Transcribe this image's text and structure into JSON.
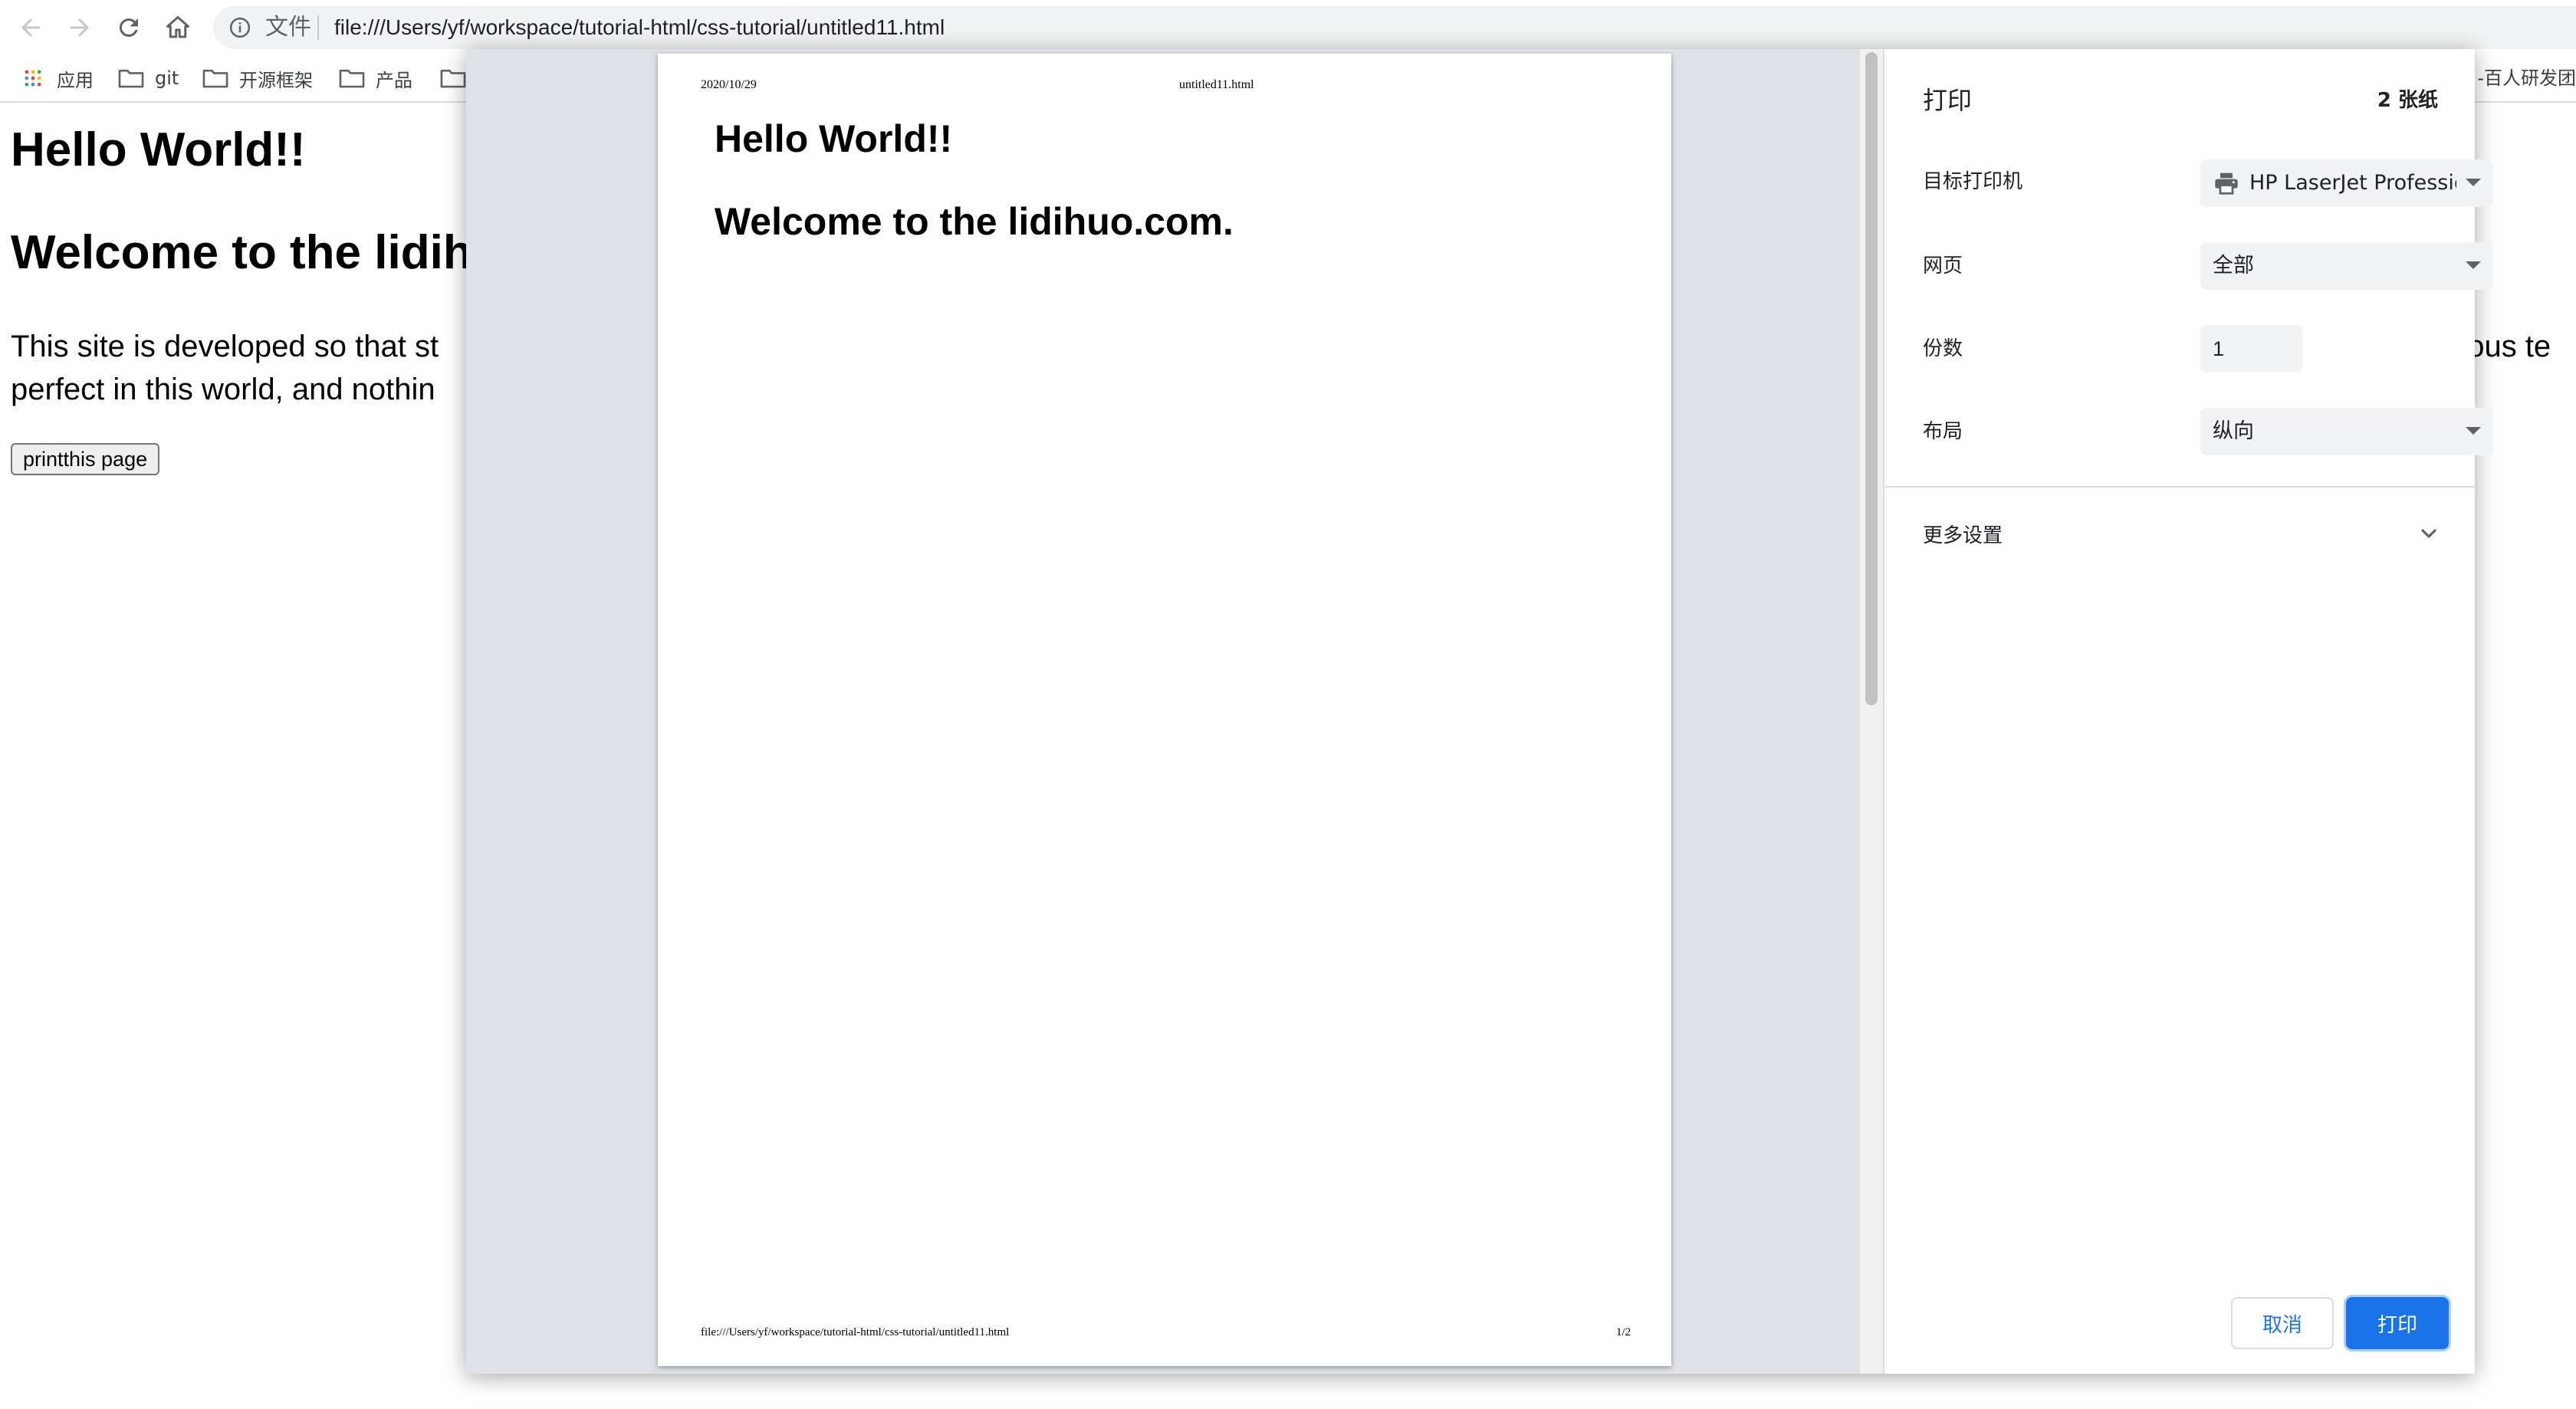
{
  "browser": {
    "scheme_chip": "文件",
    "url": "file:///Users/yf/workspace/tutorial-html/css-tutorial/untitled11.html",
    "nav_icons": [
      "back-arrow-icon",
      "forward-arrow-icon",
      "reload-icon",
      "home-icon",
      "info-icon"
    ]
  },
  "bookmarks": {
    "items": [
      {
        "label": "应用",
        "icon": "apps-grid-icon"
      },
      {
        "label": "git",
        "icon": "folder-icon"
      },
      {
        "label": "开源框架",
        "icon": "folder-icon"
      },
      {
        "label": "产品",
        "icon": "folder-icon"
      },
      {
        "label": "",
        "icon": "folder-icon"
      }
    ],
    "right_truncated": "-百人研发团"
  },
  "page": {
    "h1": "Hello World!!",
    "h2_visible": "Welcome to the lidih",
    "para_line1_visible": "This site is developed so that st",
    "para_line2_visible": "perfect in this world, and nothin",
    "para_right_visible": "rious te",
    "button_label": "printthis page"
  },
  "print_dialog": {
    "preview": {
      "header_date": "2020/10/29",
      "header_title": "untitled11.html",
      "h1": "Hello World!!",
      "h2": "Welcome to the lidihuo.com.",
      "footer_url": "file:///Users/yf/workspace/tutorial-html/css-tutorial/untitled11.html",
      "footer_page": "1/2"
    },
    "panel": {
      "title": "打印",
      "sheet_count": "2 张纸",
      "destination_label": "目标打印机",
      "destination_value": "HP LaserJet Professio",
      "pages_label": "网页",
      "pages_value": "全部",
      "copies_label": "份数",
      "copies_value": "1",
      "layout_label": "布局",
      "layout_value": "纵向",
      "more_settings": "更多设置",
      "cancel_label": "取消",
      "print_label": "打印"
    },
    "colors": {
      "accent": "#1a73e8",
      "preview_bg": "#dee1e6",
      "field_bg": "#f1f3f4"
    }
  }
}
